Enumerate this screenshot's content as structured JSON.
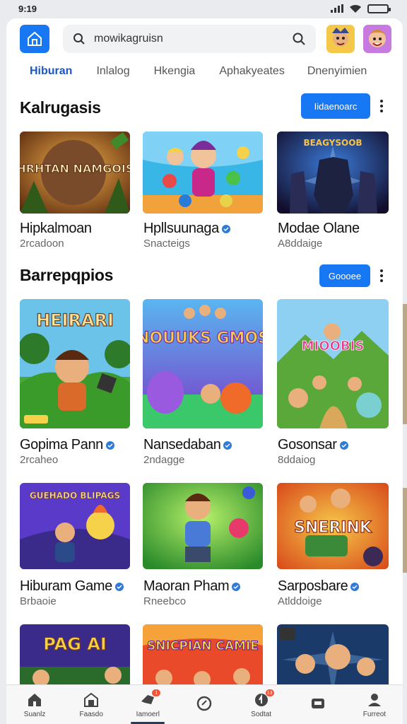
{
  "status_bar": {
    "time": "9:19"
  },
  "search": {
    "text": "mowikagruisn"
  },
  "tabs": [
    {
      "label": "Hiburan",
      "active": true
    },
    {
      "label": "Inlalog"
    },
    {
      "label": "Hkengia"
    },
    {
      "label": "Aphakyeates"
    },
    {
      "label": "Dnenyimien"
    }
  ],
  "sections": [
    {
      "title": "Kalrugasis",
      "action_label": "Iidaenoarc",
      "items": [
        {
          "title": "Hipkalmoan",
          "sub": "2rcadoon",
          "verified": false,
          "art_text": "ZHRHTAN NAMGOISE"
        },
        {
          "title": "Hpllsuunaga",
          "sub": "Snacteigs",
          "verified": true,
          "art_text": ""
        },
        {
          "title": "Modae Olane",
          "sub": "A8ddaige",
          "verified": false,
          "art_text": "BEAGYSOOB"
        }
      ]
    },
    {
      "title": "Barrepqpios",
      "action_label": "Goooee",
      "items": [
        {
          "title": "Gopima Pann",
          "sub": "2rcaheo",
          "verified": true,
          "art_text": "HEIRARI"
        },
        {
          "title": "Nansedaban",
          "sub": "2ndagge",
          "verified": true,
          "art_text": "NOUUKS GMOS"
        },
        {
          "title": "Gosonsar",
          "sub": "8ddaiog",
          "verified": true,
          "art_text": "MIOOBIS"
        },
        {
          "title": "Hiburam Game",
          "sub": "Brbaoie",
          "verified": true,
          "art_text": "GUEHADO BLIPAGS"
        },
        {
          "title": "Maoran Pham",
          "sub": "Rneebco",
          "verified": true,
          "art_text": ""
        },
        {
          "title": "Sarposbare",
          "sub": "Atlddoige",
          "verified": true,
          "art_text": "SNERINK"
        },
        {
          "title": "",
          "sub": "",
          "verified": false,
          "art_text": "PAG AI"
        },
        {
          "title": "",
          "sub": "",
          "verified": false,
          "art_text": "SNICPIAN CAMIE"
        },
        {
          "title": "",
          "sub": "",
          "verified": false,
          "art_text": ""
        }
      ]
    }
  ],
  "bottom_nav": [
    {
      "label": "Suanlz",
      "icon": "home-icon"
    },
    {
      "label": "Faasdo",
      "icon": "store-icon"
    },
    {
      "label": "Iamoerl",
      "icon": "chat-icon",
      "badge": "1",
      "active": true
    },
    {
      "label": "",
      "icon": "refresh-icon"
    },
    {
      "label": "Sodtat",
      "icon": "bell-icon",
      "badge": "13"
    },
    {
      "label": "",
      "icon": "gamepad-icon"
    },
    {
      "label": "Furreot",
      "icon": "profile-icon"
    }
  ]
}
